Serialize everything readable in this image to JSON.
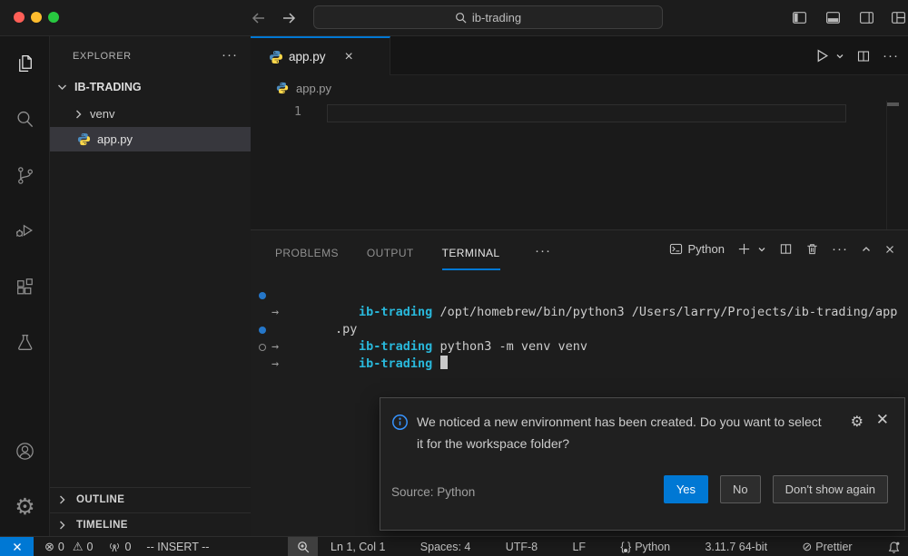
{
  "titlebar": {
    "search_value": "ib-trading",
    "window_icons": [
      "toggle-primary-sidebar",
      "toggle-panel",
      "toggle-secondary-sidebar",
      "customize-layout"
    ]
  },
  "activity_bar": {
    "items": [
      {
        "name": "explorer",
        "active": true
      },
      {
        "name": "search"
      },
      {
        "name": "source-control"
      },
      {
        "name": "run-and-debug"
      },
      {
        "name": "extensions"
      },
      {
        "name": "testing"
      },
      {
        "name": "accounts"
      },
      {
        "name": "settings"
      }
    ]
  },
  "explorer": {
    "title": "EXPLORER",
    "root": "IB-TRADING",
    "items": [
      {
        "label": "venv",
        "type": "folder-collapsed"
      },
      {
        "label": "app.py",
        "type": "python-file",
        "selected": true
      }
    ],
    "outline": "OUTLINE",
    "timeline": "TIMELINE"
  },
  "editor": {
    "tab_label": "app.py",
    "breadcrumb": "app.py",
    "line_number": "1"
  },
  "panel": {
    "tabs": [
      {
        "label": "PROBLEMS"
      },
      {
        "label": "OUTPUT"
      },
      {
        "label": "TERMINAL",
        "active": true
      }
    ],
    "terminal_profile": "Python"
  },
  "terminal": {
    "arrow": "→",
    "lines": [
      {
        "decoration": "success",
        "prompt": "ib-trading",
        "command": "/opt/homebrew/bin/python3 /Users/larry/Projects/ib-trading/app"
      },
      {
        "wrap": ".py"
      },
      {
        "decoration": "success",
        "prompt": "ib-trading",
        "command": "python3 -m venv venv"
      },
      {
        "decoration": "pending",
        "prompt": "ib-trading",
        "command": "",
        "cursor": true
      }
    ]
  },
  "notification": {
    "message": "We noticed a new environment has been created. Do you want to select it for the workspace folder?",
    "source": "Source: Python",
    "buttons": [
      {
        "label": "Yes",
        "primary": true
      },
      {
        "label": "No"
      },
      {
        "label": "Don't show again"
      }
    ]
  },
  "status_bar": {
    "errors": "0",
    "warnings": "0",
    "ports": "0",
    "vim_mode": "-- INSERT --",
    "cursor_position": "Ln 1, Col 1",
    "indentation": "Spaces: 4",
    "encoding": "UTF-8",
    "eol": "LF",
    "language": "Python",
    "interpreter": "3.11.7 64-bit",
    "formatter": "Prettier"
  },
  "colors": {
    "accent": "#0078d4",
    "terminal_prompt": "#29b8db",
    "info": "#3794ff",
    "selected_row": "#37373d",
    "traffic_red": "#ff5f57",
    "traffic_yellow": "#febc2e",
    "traffic_green": "#28c840"
  }
}
